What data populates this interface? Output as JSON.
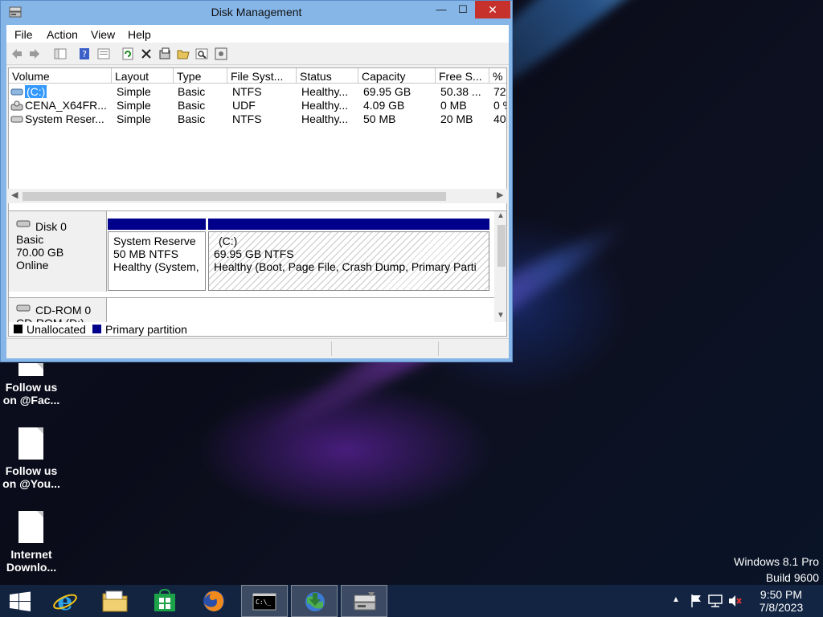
{
  "window": {
    "title": "Disk Management",
    "close_glyph": "✕",
    "min_glyph": "—",
    "max_glyph": "☐"
  },
  "menu": [
    "File",
    "Action",
    "View",
    "Help"
  ],
  "volume_table": {
    "headers": [
      "Volume",
      "Layout",
      "Type",
      "File Syst...",
      "Status",
      "Capacity",
      "Free S...",
      "%"
    ],
    "rows": [
      [
        "(C:)",
        "Simple",
        "Basic",
        "NTFS",
        "Healthy...",
        "69.95 GB",
        "50.38 ...",
        "72"
      ],
      [
        "CENA_X64FR...",
        "Simple",
        "Basic",
        "UDF",
        "Healthy...",
        "4.09 GB",
        "0 MB",
        "0 %"
      ],
      [
        "System Reser...",
        "Simple",
        "Basic",
        "NTFS",
        "Healthy...",
        "50 MB",
        "20 MB",
        "40"
      ]
    ]
  },
  "disk0": {
    "name": "Disk 0",
    "type": "Basic",
    "size": "70.00 GB",
    "state": "Online",
    "partitions": [
      {
        "name": "System Reserve",
        "size": "50 MB NTFS",
        "status": "Healthy (System,"
      },
      {
        "name": "(C:)",
        "size": "69.95 GB NTFS",
        "status": "Healthy (Boot, Page File, Crash Dump, Primary Parti"
      }
    ]
  },
  "cdrom": {
    "name": "CD-ROM 0",
    "sub": "CD-ROM (D:)"
  },
  "legend": {
    "unallocated": "Unallocated",
    "primary": "Primary partition"
  },
  "colors": {
    "primary_partition": "#00008b",
    "unallocated": "#000000",
    "close_button": "#c7312b"
  },
  "desktop_icons": [
    {
      "line1": "Follow us",
      "line2": "on @Fac..."
    },
    {
      "line1": "Follow us",
      "line2": "on @You..."
    },
    {
      "line1": "Internet",
      "line2": "Downlo..."
    }
  ],
  "watermark": {
    "line1": "Windows 8.1 Pro",
    "line2": "Build 9600"
  },
  "clock": {
    "time": "9:50 PM",
    "date": "7/8/2023"
  }
}
